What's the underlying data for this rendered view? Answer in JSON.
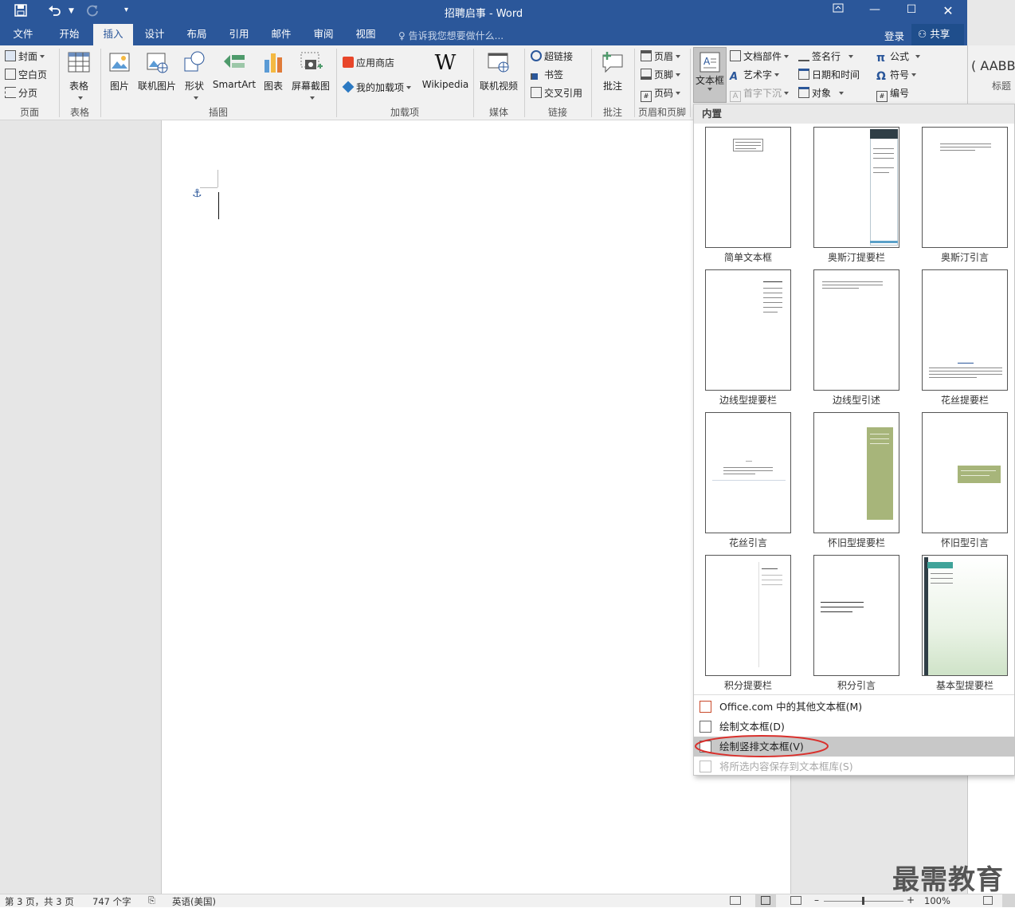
{
  "window": {
    "title": "招聘启事 - Word",
    "controls": [
      "restore-ribbon",
      "minimize",
      "maximize",
      "close"
    ]
  },
  "qat": {
    "save": "save-icon",
    "undo": "undo-icon",
    "redo": "redo-icon",
    "customize": "customize-icon"
  },
  "tabs": [
    {
      "label": "文件"
    },
    {
      "label": "开始"
    },
    {
      "label": "插入",
      "active": true
    },
    {
      "label": "设计"
    },
    {
      "label": "布局"
    },
    {
      "label": "引用"
    },
    {
      "label": "邮件"
    },
    {
      "label": "审阅"
    },
    {
      "label": "视图"
    }
  ],
  "tellme": "告诉我您想要做什么...",
  "account": {
    "login": "登录",
    "share": "共享"
  },
  "ribbon": {
    "pages": {
      "cover": "封面",
      "blank": "空白页",
      "break": "分页",
      "group": "页面"
    },
    "tables": {
      "table": "表格",
      "group": "表格"
    },
    "illustrations": {
      "picture": "图片",
      "online_picture": "联机图片",
      "shapes": "形状",
      "smartart": "SmartArt",
      "chart": "图表",
      "screenshot": "屏幕截图",
      "group": "插图"
    },
    "addins": {
      "store": "应用商店",
      "my_addins": "我的加载项",
      "wikipedia": "Wikipedia",
      "group": "加载项"
    },
    "media": {
      "online_video": "联机视频",
      "group": "媒体"
    },
    "links": {
      "hyperlink": "超链接",
      "bookmark": "书签",
      "crossref": "交叉引用",
      "group": "链接"
    },
    "comments": {
      "comment": "批注",
      "group": "批注"
    },
    "header_footer": {
      "header": "页眉",
      "footer": "页脚",
      "page_number": "页码",
      "group": "页眉和页脚"
    },
    "text": {
      "textbox": "文本框",
      "quickparts": "文档部件",
      "wordart": "艺术字",
      "dropcap": "首字下沉",
      "signature": "签名行",
      "datetime": "日期和时间",
      "object": "对象"
    },
    "symbols": {
      "equation": "公式",
      "symbol": "符号",
      "number": "编号"
    },
    "styles_peek": {
      "sample": "AABB",
      "label": "标题"
    }
  },
  "dropdown": {
    "header": "内置",
    "items": [
      {
        "label": "简单文本框"
      },
      {
        "label": "奥斯汀提要栏"
      },
      {
        "label": "奥斯汀引言"
      },
      {
        "label": "边线型提要栏"
      },
      {
        "label": "边线型引述"
      },
      {
        "label": "花丝提要栏"
      },
      {
        "label": "花丝引言"
      },
      {
        "label": "怀旧型提要栏"
      },
      {
        "label": "怀旧型引言"
      },
      {
        "label": "积分提要栏"
      },
      {
        "label": "积分引言"
      },
      {
        "label": "基本型提要栏"
      }
    ],
    "menu": [
      {
        "label": "Office.com 中的其他文本框(M)",
        "enabled": true
      },
      {
        "label": "绘制文本框(D)",
        "enabled": true
      },
      {
        "label": "绘制竖排文本框(V)",
        "enabled": true,
        "highlighted": true
      },
      {
        "label": "将所选内容保存到文本框库(S)",
        "enabled": false
      }
    ]
  },
  "status": {
    "page": "第 3 页，共 3 页",
    "words": "747 个字",
    "language": "英语(美国)",
    "zoom": "100%"
  },
  "watermark": "最需教育",
  "colors": {
    "brand": "#2b579a",
    "ribbon": "#f1f1f1",
    "highlight_circle": "#d9302c"
  }
}
